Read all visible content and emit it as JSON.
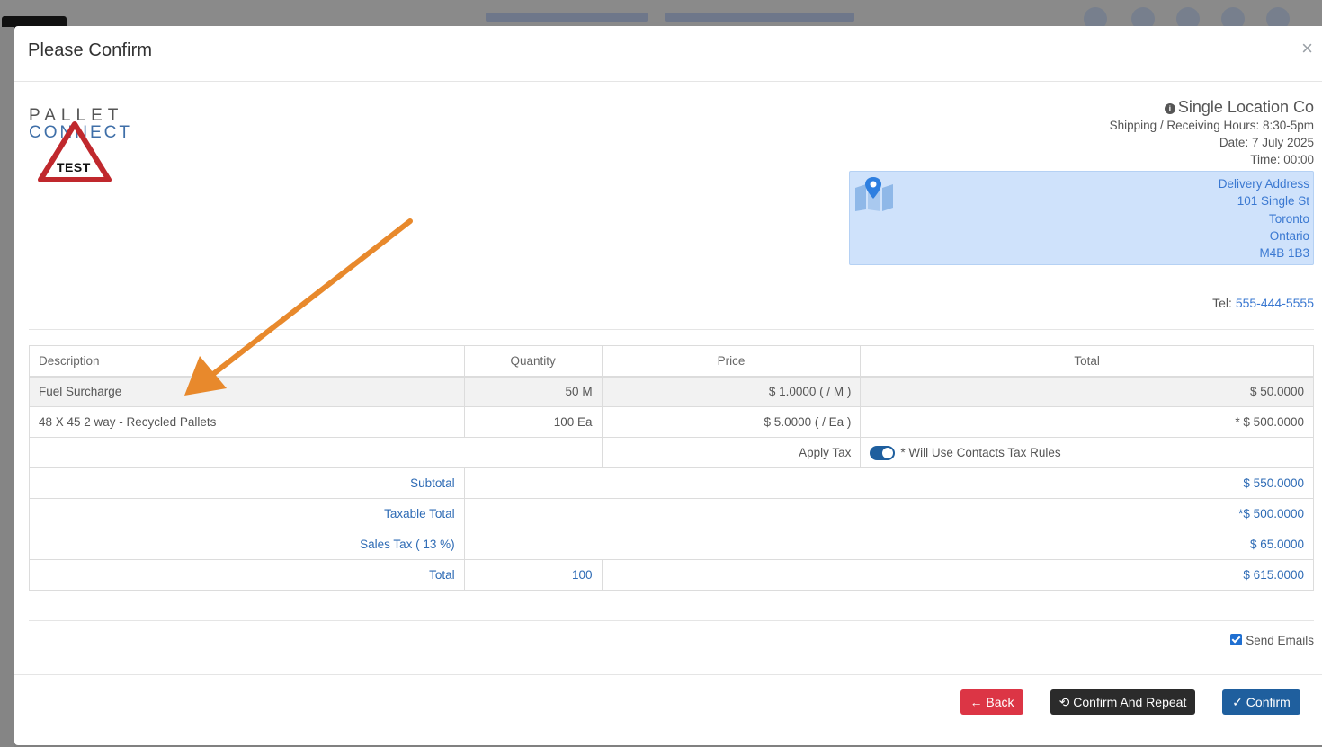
{
  "modal": {
    "title": "Please Confirm",
    "close_icon": "×"
  },
  "logo": {
    "line1": "PALLET",
    "line2": "CONNECT",
    "badge": "TEST"
  },
  "company": {
    "name": "Single Location Co",
    "hours": "Shipping / Receiving Hours: 8:30-5pm",
    "date": "Date: 7 July 2025",
    "time": "Time: 00:00"
  },
  "address": {
    "label": "Delivery Address",
    "street": "101 Single St",
    "city": "Toronto",
    "province": "Ontario",
    "postal": "M4B 1B3"
  },
  "tel": {
    "label": "Tel:",
    "number": "555-444-5555"
  },
  "table": {
    "headers": [
      "Description",
      "Quantity",
      "Price",
      "Total"
    ],
    "rows": [
      {
        "description": "Fuel Surcharge",
        "quantity": "50 M",
        "price": "$ 1.0000 ( / M )",
        "total": "$ 50.0000"
      },
      {
        "description": "48 X 45 2 way - Recycled Pallets",
        "quantity": "100 Ea",
        "price": "$ 5.0000 ( / Ea )",
        "total": "* $ 500.0000"
      }
    ],
    "apply_tax_label": "Apply Tax",
    "tax_note": "* Will Use Contacts Tax Rules",
    "subtotal_label": "Subtotal",
    "subtotal_value": "$ 550.0000",
    "taxable_label": "Taxable Total",
    "taxable_value": "*$ 500.0000",
    "sales_tax_label": "Sales Tax ( 13 %)",
    "sales_tax_value": "$ 65.0000",
    "total_label": "Total",
    "total_qty": "100",
    "total_value": "$ 615.0000"
  },
  "send_emails_label": "Send Emails",
  "buttons": {
    "back": "← Back",
    "confirm_repeat": "Confirm And Repeat",
    "confirm": "✓ Confirm"
  },
  "colors": {
    "accent": "#1f5f9e",
    "danger": "#dc3545",
    "dark": "#2b2b2b",
    "annotation": "#e8892c",
    "address_bg": "#cfe2fb"
  }
}
